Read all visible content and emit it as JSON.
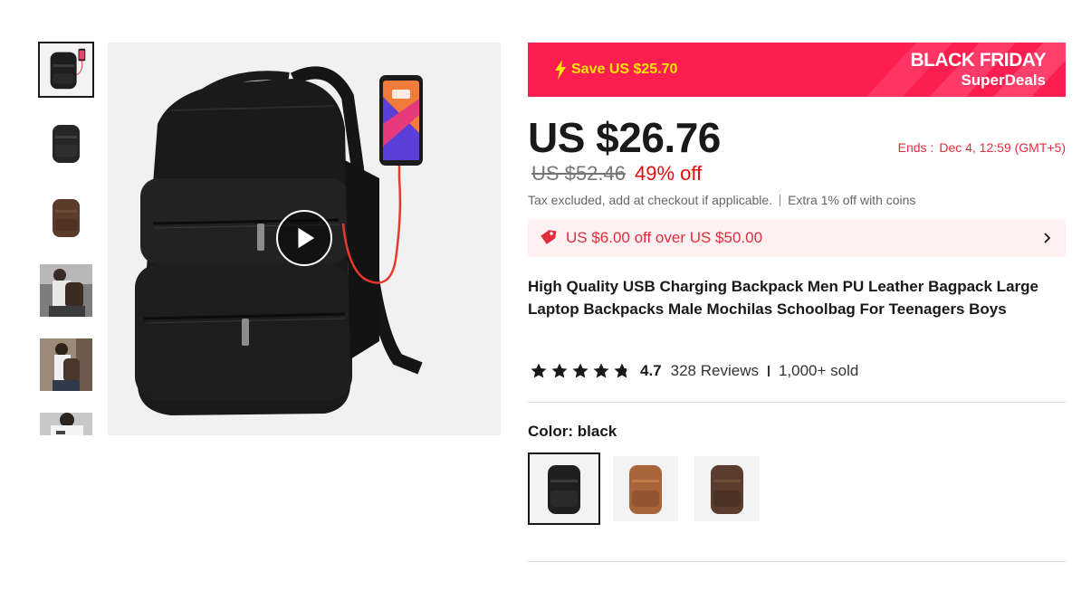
{
  "product": {
    "thumbnails": [
      {
        "name": "black-backpack-with-phone",
        "color": "#1e1e1e",
        "active": true
      },
      {
        "name": "black-backpack",
        "color": "#262626",
        "active": false
      },
      {
        "name": "brown-backpack",
        "color": "#5b3b2a",
        "active": false
      },
      {
        "name": "model-photo-1",
        "color": "#4a3f36",
        "active": false
      },
      {
        "name": "model-photo-2",
        "color": "#57463a",
        "active": false
      },
      {
        "name": "model-photo-3",
        "color": "#8a8a8a",
        "active": false
      }
    ],
    "title": "High Quality USB Charging Backpack Men PU Leather Bagpack Large Laptop Backpacks Male Mochilas Schoolbag For Teenagers Boys"
  },
  "promo": {
    "save_text": "Save US $25.70",
    "event_title": "BLACK FRIDAY",
    "event_subtitle": "SuperDeals",
    "banner_color": "#fd1e50"
  },
  "pricing": {
    "current_price": "US $26.76",
    "original_price": "US $52.46",
    "discount": "49% off",
    "ends_label": "Ends :",
    "ends_value": "Dec 4, 12:59 (GMT+5)",
    "tax_note": "Tax excluded, add at checkout if applicable.",
    "coins_note": "Extra 1% off with coins"
  },
  "coupon": {
    "text": "US $6.00 off over US $50.00",
    "icon": "tag-icon"
  },
  "rating": {
    "score": "4.7",
    "stars": 4.7,
    "reviews": "328 Reviews",
    "sold": "1,000+ sold"
  },
  "color_option": {
    "label": "Color: black",
    "swatches": [
      {
        "name": "black",
        "color": "#1f1f1f",
        "selected": true
      },
      {
        "name": "brown",
        "color": "#a8643a",
        "selected": false
      },
      {
        "name": "coffee",
        "color": "#5a3d2e",
        "selected": false
      }
    ]
  }
}
